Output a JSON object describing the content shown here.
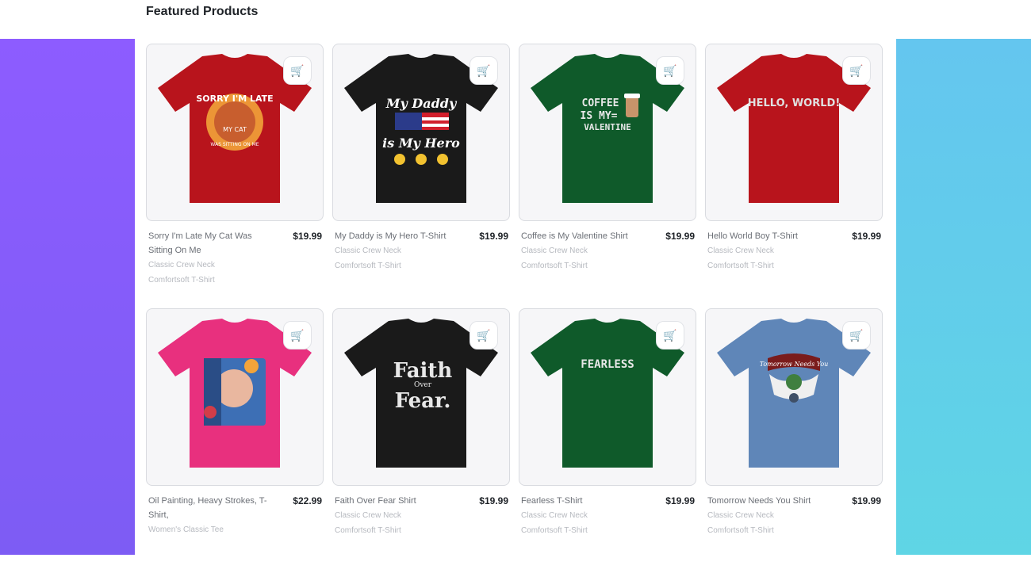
{
  "header": {
    "title": "Featured Products"
  },
  "colors": {
    "left_panel": "#8d5cff",
    "right_panel": "#5fd5e5",
    "card_bg": "#f6f6f8"
  },
  "products": [
    {
      "title": "Sorry I'm Late My Cat Was Sitting On Me",
      "price": "$19.99",
      "sub1": "Classic Crew Neck",
      "sub2": "Comfortsoft T-Shirt",
      "shirt_color": "#b8141c",
      "design": [
        "SORRY I'M LATE",
        "MY CAT",
        "WAS SITTING ON ME"
      ]
    },
    {
      "title": "My Daddy is My Hero T-Shirt",
      "price": "$19.99",
      "sub1": "Classic Crew Neck",
      "sub2": "Comfortsoft T-Shirt",
      "shirt_color": "#1a1a1a",
      "design": [
        "My Daddy",
        "is My Hero"
      ]
    },
    {
      "title": "Coffee is My Valentine Shirt",
      "price": "$19.99",
      "sub1": "Classic Crew Neck",
      "sub2": "Comfortsoft T-Shirt",
      "shirt_color": "#0f5a2a",
      "design": [
        "COFFEE",
        "IS MY=",
        "VALENTINE"
      ]
    },
    {
      "title": "Hello World Boy T-Shirt",
      "price": "$19.99",
      "sub1": "Classic Crew Neck",
      "sub2": "Comfortsoft T-Shirt",
      "shirt_color": "#b8141c",
      "design": [
        "HELLO, WORLD!"
      ]
    },
    {
      "title": "Oil Painting, Heavy Strokes, T-Shirt,",
      "price": "$22.99",
      "sub1": "Women's Classic Tee",
      "sub2": "",
      "shirt_color": "#e8307e",
      "design": []
    },
    {
      "title": "Faith Over Fear Shirt",
      "price": "$19.99",
      "sub1": "Classic Crew Neck",
      "sub2": "Comfortsoft T-Shirt",
      "shirt_color": "#1a1a1a",
      "design": [
        "Faith",
        "Over",
        "Fear."
      ]
    },
    {
      "title": "Fearless T-Shirt",
      "price": "$19.99",
      "sub1": "Classic Crew Neck",
      "sub2": "Comfortsoft T-Shirt",
      "shirt_color": "#0f5a2a",
      "design": [
        "FEARLESS"
      ]
    },
    {
      "title": "Tomorrow Needs You Shirt",
      "price": "$19.99",
      "sub1": "Classic Crew Neck",
      "sub2": "Comfortsoft T-Shirt",
      "shirt_color": "#5f86b8",
      "design": [
        "Tomorrow Needs You"
      ]
    }
  ]
}
